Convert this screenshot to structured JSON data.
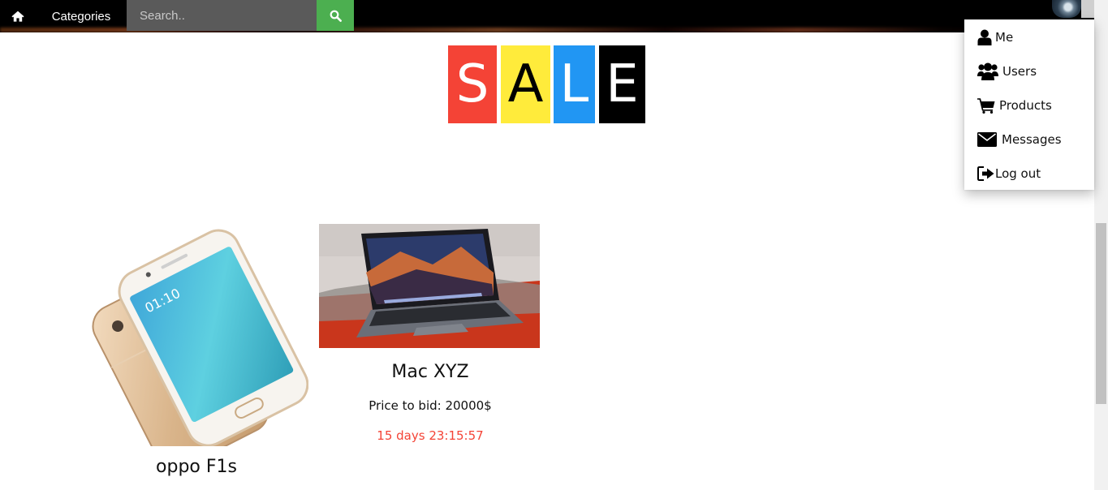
{
  "topbar": {
    "home_icon": "home-icon",
    "categories_label": "Categories",
    "search_placeholder": "Search..",
    "search_icon": "search-icon",
    "search_button_color": "#4caf50"
  },
  "user_menu": {
    "avatar_icon": "user-avatar",
    "items": [
      {
        "label": "Me",
        "icon": "user-icon"
      },
      {
        "label": "Users",
        "icon": "users-icon"
      },
      {
        "label": "Products",
        "icon": "shopping-cart-icon"
      },
      {
        "label": "Messages",
        "icon": "envelope-icon"
      },
      {
        "label": "Log out",
        "icon": "sign-out-icon"
      }
    ]
  },
  "banner": {
    "letters": [
      {
        "char": "S",
        "bg": "#f44336",
        "fg": "#ffffff"
      },
      {
        "char": "A",
        "bg": "#ffeb3b",
        "fg": "#000000"
      },
      {
        "char": "L",
        "bg": "#2196f3",
        "fg": "#ffffff"
      },
      {
        "char": "E",
        "bg": "#000000",
        "fg": "#ffffff"
      }
    ]
  },
  "products": [
    {
      "name": "oppo F1s",
      "image": "phone-image"
    },
    {
      "name": "Mac XYZ",
      "image": "laptop-image",
      "price_text": "Price to bid: 20000$",
      "timer": "15 days 23:15:57",
      "timer_color": "#f44336"
    }
  ]
}
